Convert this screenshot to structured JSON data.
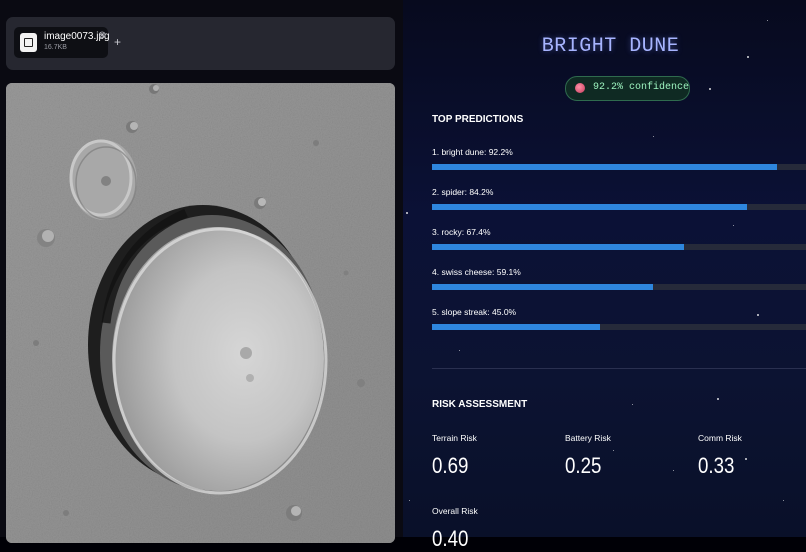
{
  "uploader": {
    "file_name": "image0073.jpg",
    "file_size": "16.7KB",
    "close_icon": "close-icon",
    "add_label": "+"
  },
  "prediction": {
    "label": "BRIGHT DUNE",
    "confidence_text": "92.2% confidence",
    "confidence_icon": "brain-icon"
  },
  "top_predictions": {
    "heading": "TOP PREDICTIONS",
    "items": [
      {
        "label": "1. bright dune: 92.2%",
        "value": 92.2
      },
      {
        "label": "2. spider: 84.2%",
        "value": 84.2
      },
      {
        "label": "3. rocky: 67.4%",
        "value": 67.4
      },
      {
        "label": "4. swiss cheese: 59.1%",
        "value": 59.1
      },
      {
        "label": "5. slope streak: 45.0%",
        "value": 45.0
      }
    ]
  },
  "risk": {
    "heading": "RISK ASSESSMENT",
    "terrain": {
      "label": "Terrain Risk",
      "value": "0.69"
    },
    "battery": {
      "label": "Battery Risk",
      "value": "0.25"
    },
    "comm": {
      "label": "Comm Risk",
      "value": "0.33"
    },
    "overall": {
      "label": "Overall Risk",
      "value": "0.40"
    }
  },
  "colors": {
    "bar_fill": "#2e86de",
    "bar_track": "#262a3a",
    "title": "#a7b4ff",
    "confidence_text": "#9df3bf"
  }
}
